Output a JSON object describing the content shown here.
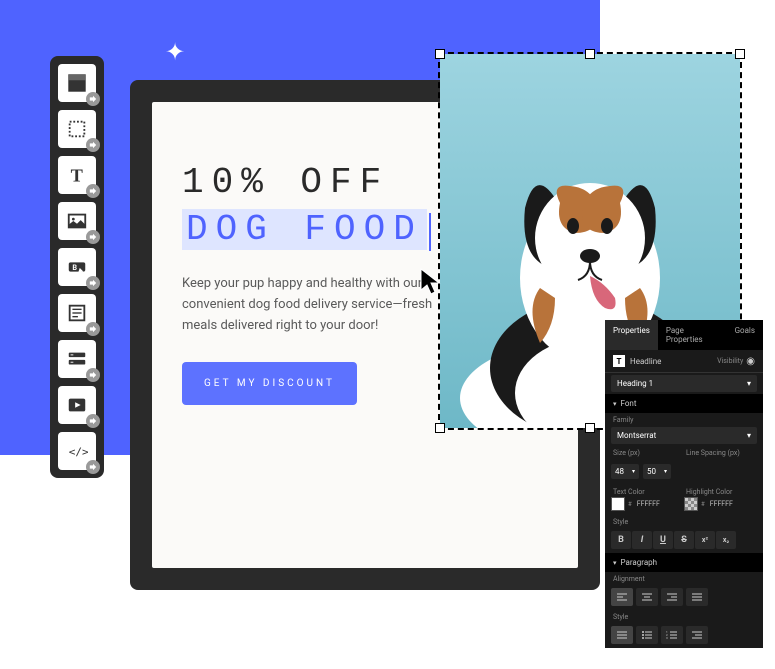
{
  "toolbar": {
    "tools": [
      {
        "name": "section-tool"
      },
      {
        "name": "box-tool"
      },
      {
        "name": "text-tool"
      },
      {
        "name": "image-tool"
      },
      {
        "name": "button-tool"
      },
      {
        "name": "form-tool"
      },
      {
        "name": "forms-block-tool"
      },
      {
        "name": "video-tool"
      },
      {
        "name": "code-tool"
      }
    ]
  },
  "canvas": {
    "headline_line1": "10% OFF",
    "headline_line2": "DOG FOOD",
    "description": "Keep your pup happy and healthy with our convenient dog food delivery service—fresh meals delivered right to your door!",
    "cta_label": "GET MY DISCOUNT"
  },
  "panel": {
    "tabs": {
      "properties": "Properties",
      "page": "Page Properties",
      "goals": "Goals"
    },
    "element_type_icon": "T",
    "element_type": "Headline",
    "visibility_label": "Visibility",
    "heading_level": "Heading 1",
    "sections": {
      "font": "Font",
      "family_label": "Family",
      "family_value": "Montserrat",
      "size_label": "Size (px)",
      "size_value": "48",
      "line_spacing_label": "Line Spacing (px)",
      "line_spacing_value": "50",
      "text_color_label": "Text Color",
      "text_color_value": "FFFFFF",
      "highlight_color_label": "Highlight Color",
      "highlight_color_value": "FFFFFF",
      "style_label": "Style",
      "style_buttons": {
        "bold": "B",
        "italic": "I",
        "underline": "U",
        "strike": "S",
        "sup": "x²",
        "sub": "x₂"
      },
      "paragraph": "Paragraph",
      "alignment_label": "Alignment"
    }
  }
}
